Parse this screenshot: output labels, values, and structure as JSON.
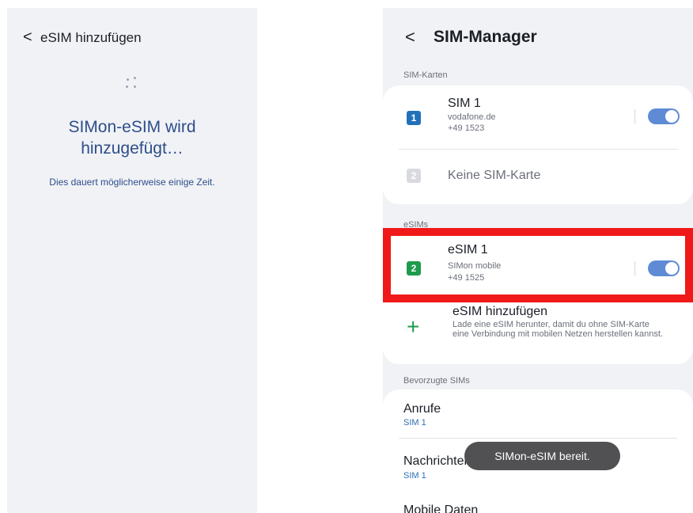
{
  "left_screen": {
    "back_symbol": "<",
    "title": "eSIM hinzufügen",
    "heading_line1": "SIMon-eSIM wird",
    "heading_line2": "hinzugefügt…",
    "subtitle": "Dies dauert möglicherweise einige Zeit."
  },
  "right_screen": {
    "back_symbol": "<",
    "title": "SIM-Manager",
    "sim_section_label": "SIM-Karten",
    "sims": [
      {
        "badge": "1",
        "name": "SIM 1",
        "operator": "vodafone.de",
        "number": "+49 1523",
        "enabled": true
      },
      {
        "badge": "2",
        "name": "Keine SIM-Karte"
      }
    ],
    "esim_section_label": "eSIMs",
    "esims": [
      {
        "badge": "2",
        "name": "eSIM 1",
        "operator": "SIMon mobile",
        "number": "+49 1525",
        "enabled": true
      }
    ],
    "add_esim": {
      "title": "eSIM hinzufügen",
      "description": "Lade eine eSIM herunter, damit du ohne SIM-Karte eine Verbindung mit mobilen Netzen herstellen kannst."
    },
    "preferred_section_label": "Bevorzugte SIMs",
    "preferred": [
      {
        "label": "Anrufe",
        "value": "SIM 1"
      },
      {
        "label": "Nachrichten",
        "value": "SIM 1"
      },
      {
        "label": "Mobile Daten",
        "value": ""
      }
    ],
    "toast": "SIMon-eSIM bereit."
  },
  "colors": {
    "highlight": "#f01919",
    "toggle_on": "#5f8bd5",
    "sim1_badge": "#2271b8",
    "esim_badge": "#1d9b4c",
    "heading_text": "#2d4e8a"
  },
  "icons": [
    "back-chevron-icon",
    "loading-spinner-icon",
    "sim-card-icon",
    "esim-icon",
    "plus-icon",
    "toggle-switch-icon"
  ]
}
